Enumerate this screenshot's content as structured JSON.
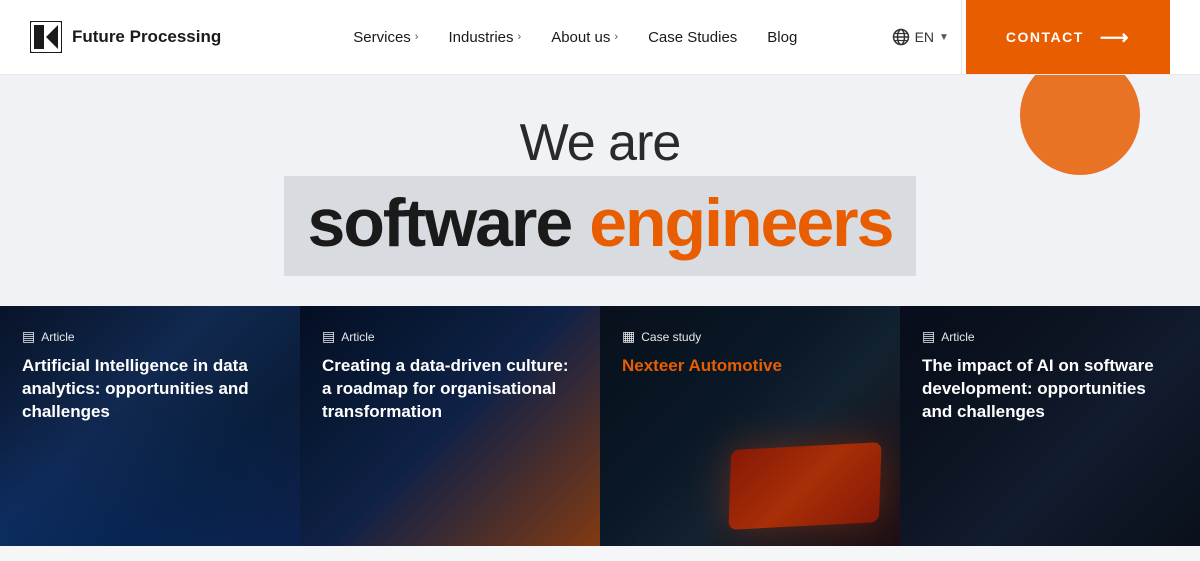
{
  "header": {
    "logo_text": "Future Processing",
    "nav": [
      {
        "label": "Services",
        "has_chevron": true
      },
      {
        "label": "Industries",
        "has_chevron": true
      },
      {
        "label": "About us",
        "has_chevron": true
      },
      {
        "label": "Case Studies",
        "has_chevron": false
      },
      {
        "label": "Blog",
        "has_chevron": false
      }
    ],
    "lang_label": "EN",
    "contact_label": "CONTACT"
  },
  "hero": {
    "subtitle": "We are",
    "bold": "software",
    "orange": "engineers"
  },
  "cards": [
    {
      "type": "Article",
      "title": "Artificial Intelligence in data analytics: opportunities and challenges"
    },
    {
      "type": "Article",
      "title": "Creating a data-driven culture: a roadmap for organisational transformation"
    },
    {
      "type": "Case study",
      "title": "Nexteer Automotive",
      "title_color": "orange"
    },
    {
      "type": "Article",
      "title": "The impact of AI on software development: opportunities and challenges"
    }
  ]
}
